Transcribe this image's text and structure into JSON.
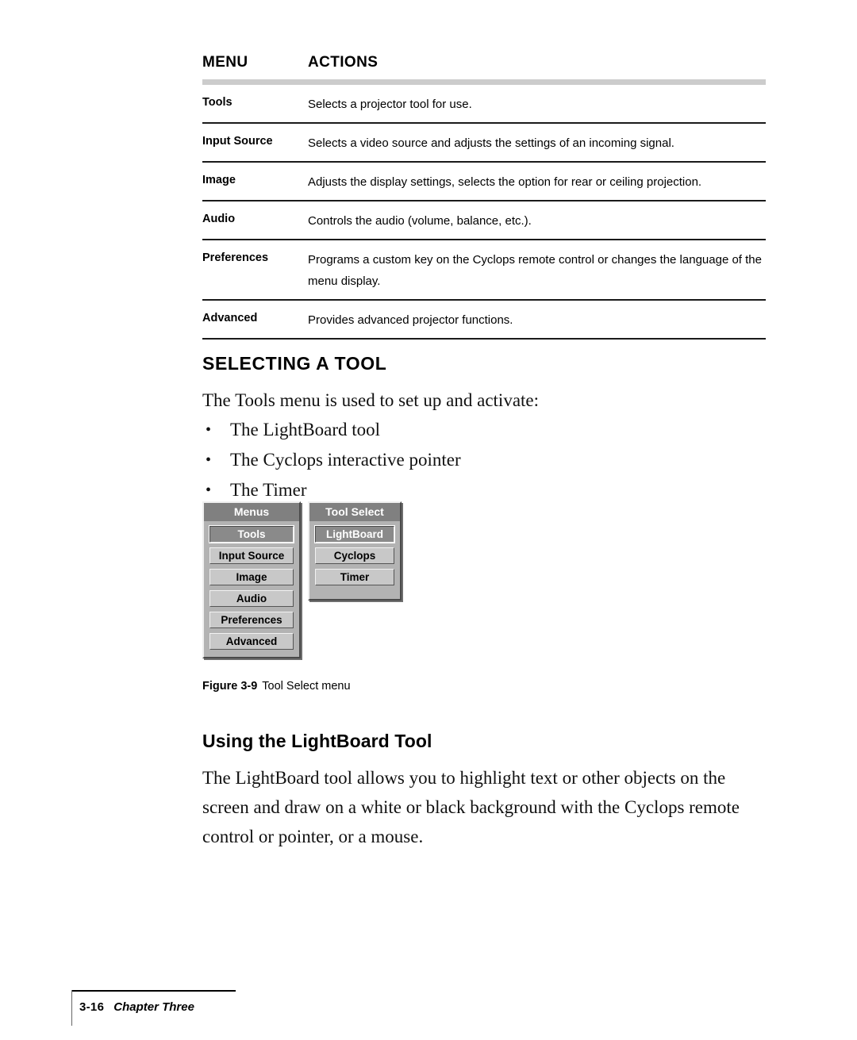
{
  "table": {
    "headers": [
      "MENU",
      "ACTIONS"
    ],
    "rows": [
      {
        "menu": "Tools",
        "action": "Selects a projector tool for use."
      },
      {
        "menu": "Input Source",
        "action": "Selects a video source and adjusts the settings of an incoming signal."
      },
      {
        "menu": "Image",
        "action": "Adjusts the display settings, selects the option for rear or ceiling projection."
      },
      {
        "menu": "Audio",
        "action": "Controls the audio (volume, balance, etc.)."
      },
      {
        "menu": "Preferences",
        "action": "Programs a custom key on the Cyclops remote control or changes the language of the menu display."
      },
      {
        "menu": "Advanced",
        "action": "Provides advanced projector functions."
      }
    ]
  },
  "section": {
    "heading": "SELECTING A TOOL",
    "intro": "The Tools menu is used to set up and activate:",
    "bullets": [
      "The LightBoard tool",
      "The Cyclops interactive pointer",
      "The Timer"
    ]
  },
  "figure": {
    "menus_window": {
      "title": "Menus",
      "items": [
        {
          "label": "Tools",
          "selected": true
        },
        {
          "label": "Input Source",
          "selected": false
        },
        {
          "label": "Image",
          "selected": false
        },
        {
          "label": "Audio",
          "selected": false
        },
        {
          "label": "Preferences",
          "selected": false
        },
        {
          "label": "Advanced",
          "selected": false
        }
      ]
    },
    "tool_select_window": {
      "title": "Tool Select",
      "items": [
        {
          "label": "LightBoard",
          "selected": true
        },
        {
          "label": "Cyclops",
          "selected": false
        },
        {
          "label": "Timer",
          "selected": false
        }
      ]
    },
    "caption_number": "Figure 3-9",
    "caption_text": "Tool Select menu"
  },
  "subsection": {
    "heading": "Using the LightBoard Tool",
    "paragraph": "The LightBoard tool allows you to highlight text or other objects on the screen and draw on a white or black background with the Cyclops remote control or pointer, or a mouse."
  },
  "footer": {
    "page_number": "3-16",
    "chapter": "Chapter Three"
  },
  "colors": {
    "header_bar": "#cccccc",
    "rule": "#1a1a1a",
    "window_title_bg": "#808080",
    "window_body_bg": "#b3b3b3",
    "button_bg": "#c8c8c8",
    "button_selected_bg": "#8a8a8a"
  }
}
